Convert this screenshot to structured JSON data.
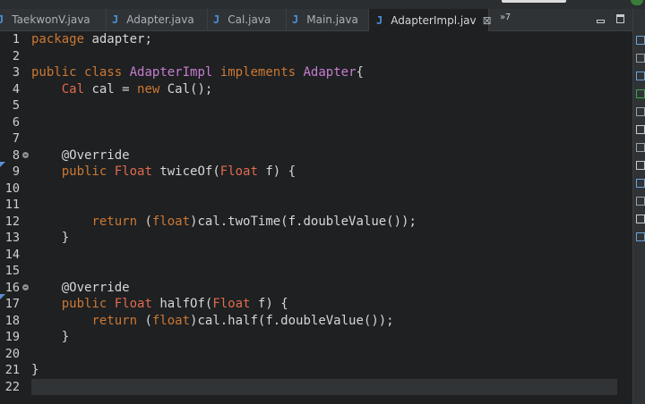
{
  "tabs": [
    {
      "label": "TaekwonV.java",
      "icon": "java-file-icon"
    },
    {
      "label": "Adapter.java",
      "icon": "java-file-icon"
    },
    {
      "label": "Cal.java",
      "icon": "java-file-icon"
    },
    {
      "label": "Main.java",
      "icon": "java-file-icon"
    },
    {
      "label": "AdapterImpl.jav",
      "icon": "java-file-icon",
      "active": true
    }
  ],
  "tab_overflow": "»7",
  "editor": {
    "lines": [
      {
        "n": "1",
        "tokens": [
          [
            "kw",
            "package"
          ],
          [
            "plain",
            " adapter;"
          ]
        ]
      },
      {
        "n": "2",
        "tokens": []
      },
      {
        "n": "3",
        "tokens": [
          [
            "kw",
            "public"
          ],
          [
            "plain",
            " "
          ],
          [
            "kw",
            "class"
          ],
          [
            "plain",
            " "
          ],
          [
            "cls",
            "AdapterImpl"
          ],
          [
            "plain",
            " "
          ],
          [
            "kw",
            "implements"
          ],
          [
            "plain",
            " "
          ],
          [
            "cls",
            "Adapter"
          ],
          [
            "plain",
            "{"
          ]
        ]
      },
      {
        "n": "4",
        "tokens": [
          [
            "plain",
            "    "
          ],
          [
            "ty",
            "Cal"
          ],
          [
            "plain",
            " cal = "
          ],
          [
            "kw",
            "new"
          ],
          [
            "plain",
            " Cal();"
          ]
        ]
      },
      {
        "n": "5",
        "tokens": []
      },
      {
        "n": "6",
        "tokens": []
      },
      {
        "n": "7",
        "tokens": []
      },
      {
        "n": "8",
        "fold": true,
        "tokens": [
          [
            "plain",
            "    @Override"
          ]
        ]
      },
      {
        "n": "9",
        "marker": true,
        "tokens": [
          [
            "plain",
            "    "
          ],
          [
            "kw",
            "public"
          ],
          [
            "plain",
            " "
          ],
          [
            "ty",
            "Float"
          ],
          [
            "plain",
            " twiceOf("
          ],
          [
            "ty",
            "Float"
          ],
          [
            "plain",
            " f) {"
          ]
        ]
      },
      {
        "n": "10",
        "tokens": []
      },
      {
        "n": "11",
        "tokens": []
      },
      {
        "n": "12",
        "tokens": [
          [
            "plain",
            "        "
          ],
          [
            "kw",
            "return"
          ],
          [
            "plain",
            " ("
          ],
          [
            "kw",
            "float"
          ],
          [
            "plain",
            ")cal.twoTime(f.doubleValue());"
          ]
        ]
      },
      {
        "n": "13",
        "tokens": [
          [
            "plain",
            "    }"
          ]
        ]
      },
      {
        "n": "14",
        "tokens": []
      },
      {
        "n": "15",
        "tokens": []
      },
      {
        "n": "16",
        "fold": true,
        "tokens": [
          [
            "plain",
            "    @Override"
          ]
        ]
      },
      {
        "n": "17",
        "marker": true,
        "tokens": [
          [
            "plain",
            "    "
          ],
          [
            "kw",
            "public"
          ],
          [
            "plain",
            " "
          ],
          [
            "ty",
            "Float"
          ],
          [
            "plain",
            " halfOf("
          ],
          [
            "ty",
            "Float"
          ],
          [
            "plain",
            " f) {"
          ]
        ]
      },
      {
        "n": "18",
        "tokens": [
          [
            "plain",
            "        "
          ],
          [
            "kw",
            "return"
          ],
          [
            "plain",
            " ("
          ],
          [
            "kw",
            "float"
          ],
          [
            "plain",
            ")cal.half(f.doubleValue());"
          ]
        ]
      },
      {
        "n": "19",
        "tokens": [
          [
            "plain",
            "    }"
          ]
        ]
      },
      {
        "n": "20",
        "tokens": []
      },
      {
        "n": "21",
        "tokens": [
          [
            "plain",
            "}"
          ]
        ]
      },
      {
        "n": "22",
        "current": true,
        "tokens": []
      }
    ]
  },
  "colors": {
    "background": "#1e2022",
    "keyword": "#cc7832",
    "type": "#e06b4d",
    "class": "#c77dcf",
    "text": "#d6d6d6",
    "java_icon": "#4a8fd8"
  },
  "right_toolbar_icons": [
    "outline-icon",
    "task-icon",
    "tree-icon",
    "run-icon",
    "problems-icon",
    "console-icon",
    "view-icon",
    "hierarchy-icon",
    "debug-icon",
    "terminal-icon",
    "search-icon",
    "monitor-icon"
  ]
}
